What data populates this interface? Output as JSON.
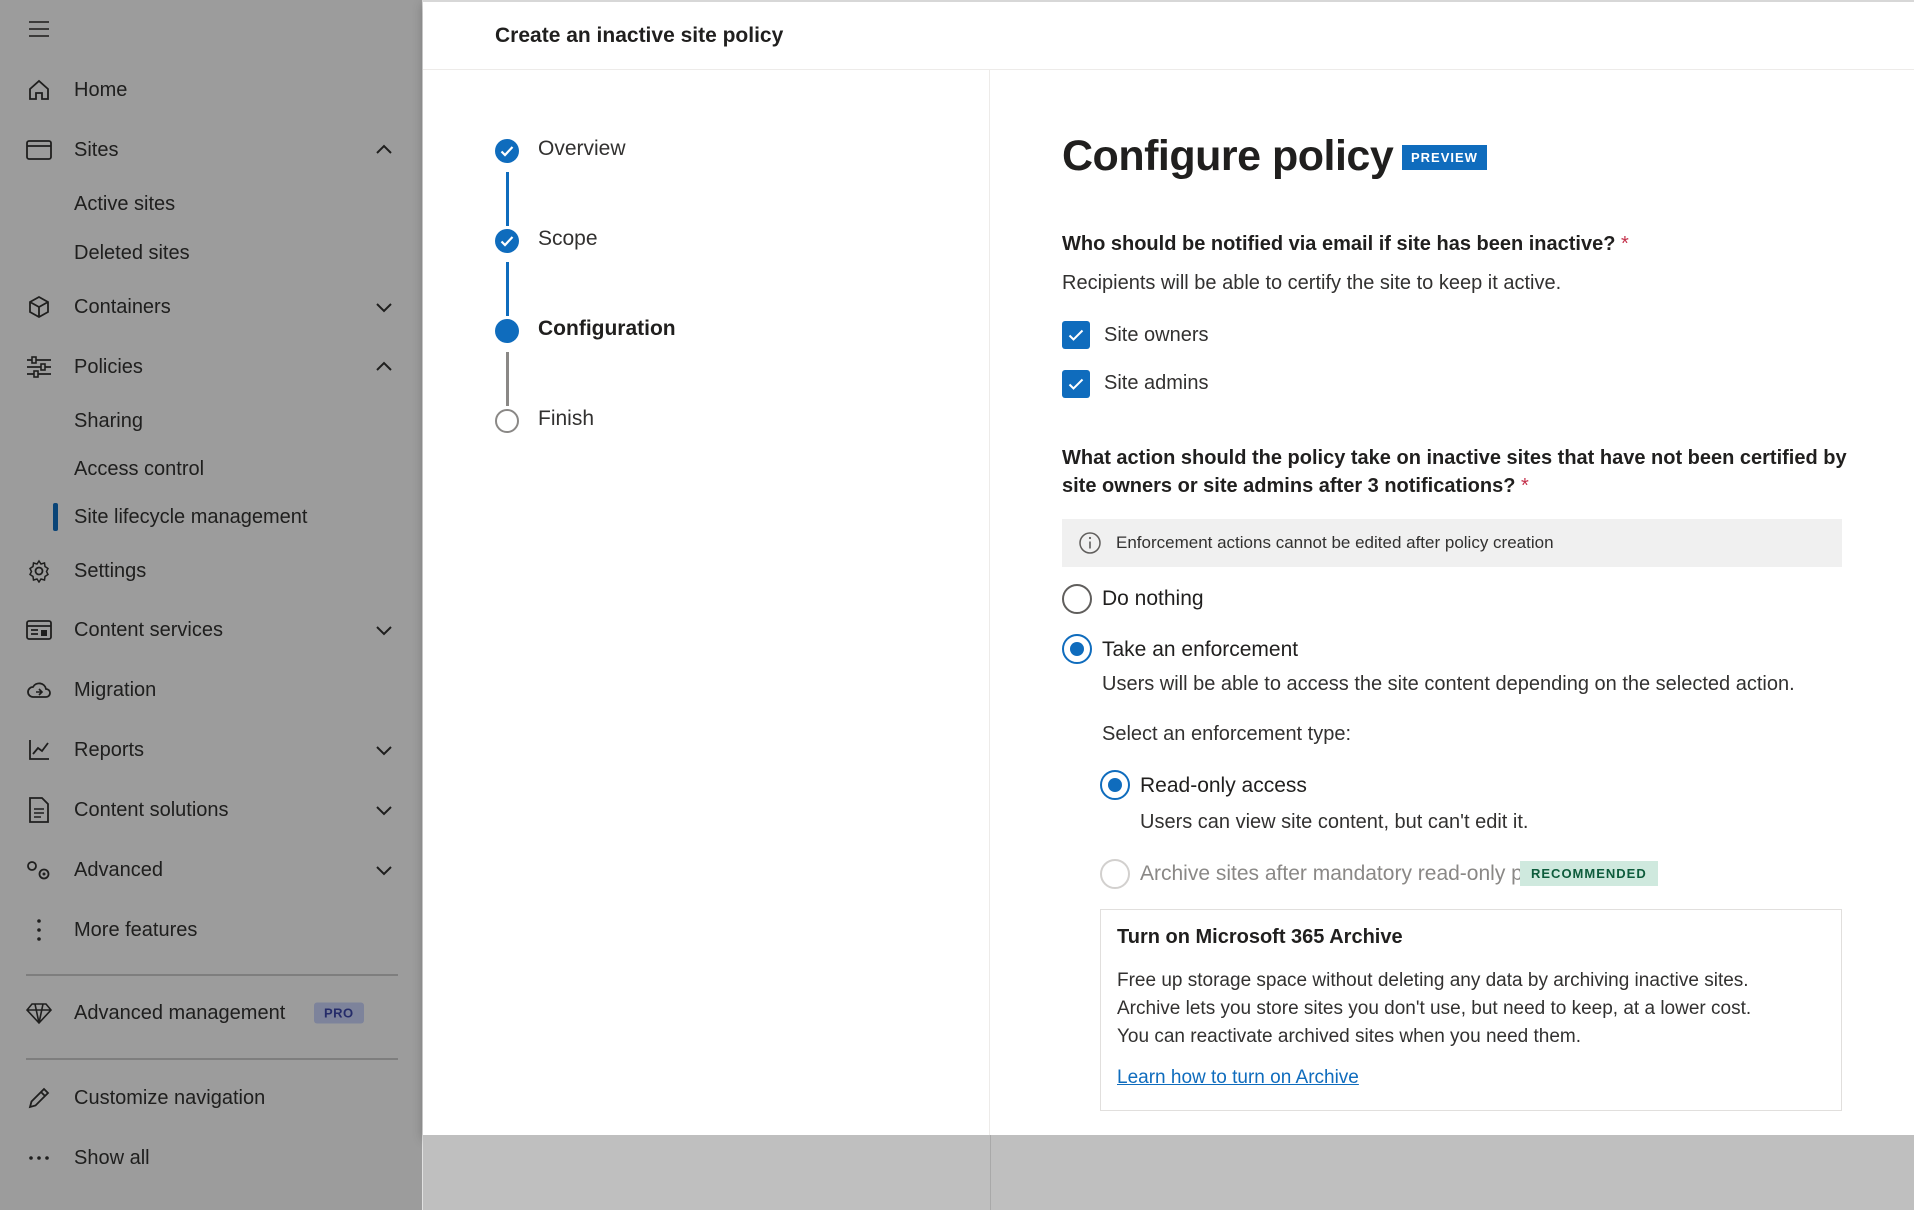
{
  "nav": {
    "items": [
      {
        "label": "Home",
        "icon": "home-icon"
      },
      {
        "label": "Sites",
        "icon": "sites-icon",
        "expanded": true
      },
      {
        "label": "Active sites"
      },
      {
        "label": "Deleted sites"
      },
      {
        "label": "Containers",
        "icon": "containers-icon",
        "expanded": false
      },
      {
        "label": "Policies",
        "icon": "policies-icon",
        "expanded": true
      },
      {
        "label": "Sharing"
      },
      {
        "label": "Access control"
      },
      {
        "label": "Site lifecycle management",
        "active": true
      },
      {
        "label": "Settings",
        "icon": "settings-icon"
      },
      {
        "label": "Content services",
        "icon": "content-services-icon",
        "expanded": false
      },
      {
        "label": "Migration",
        "icon": "migration-icon"
      },
      {
        "label": "Reports",
        "icon": "reports-icon",
        "expanded": false
      },
      {
        "label": "Content solutions",
        "icon": "content-solutions-icon",
        "expanded": false
      },
      {
        "label": "Advanced",
        "icon": "advanced-icon",
        "expanded": false
      },
      {
        "label": "More features",
        "icon": "more-features-icon"
      },
      {
        "label": "Advanced management",
        "icon": "diamond-icon",
        "badge": "PRO"
      },
      {
        "label": "Customize navigation",
        "icon": "pencil-icon"
      },
      {
        "label": "Show all",
        "icon": "ellipsis-icon"
      }
    ]
  },
  "panel": {
    "title": "Create an inactive site policy",
    "steps": [
      {
        "label": "Overview",
        "state": "done"
      },
      {
        "label": "Scope",
        "state": "done"
      },
      {
        "label": "Configuration",
        "state": "current"
      },
      {
        "label": "Finish",
        "state": "todo"
      }
    ],
    "configure": {
      "title": "Configure policy",
      "preview_badge": "PREVIEW",
      "q1": "Who should be notified via email if site has been inactive?",
      "required_mark": "*",
      "q1_help": "Recipients will be able to certify the site to keep it active.",
      "cb_site_owners": "Site owners",
      "cb_site_admins": "Site admins",
      "q2": "What action should the policy take on inactive sites that have not been certified by site owners or site admins after 3 notifications?",
      "info_text": "Enforcement actions cannot be edited after policy creation",
      "radio_do_nothing": "Do nothing",
      "radio_take_enforcement": "Take an enforcement",
      "enforcement_help": "Users will be able to access the site content depending on the selected action.",
      "select_type_label": "Select an enforcement type:",
      "radio_read_only": "Read-only access",
      "read_only_help": "Users can view site content, but can't edit it.",
      "radio_archive": "Archive sites after mandatory read-only period",
      "recommended_badge": "RECOMMENDED",
      "archive_card": {
        "title": "Turn on Microsoft 365 Archive",
        "body_line1": "Free up storage space without deleting any data by archiving inactive sites.",
        "body_line2": "Archive lets you store sites you don't use, but need to keep, at a lower cost.",
        "body_line3": "You can reactivate archived sites when you need them.",
        "link": "Learn how to turn on Archive"
      }
    }
  },
  "colors": {
    "accent": "#0f6cbd",
    "required": "#c4314b",
    "recommended_bg": "#cfe9de",
    "pro_badge_bg": "#c7d0f5"
  }
}
